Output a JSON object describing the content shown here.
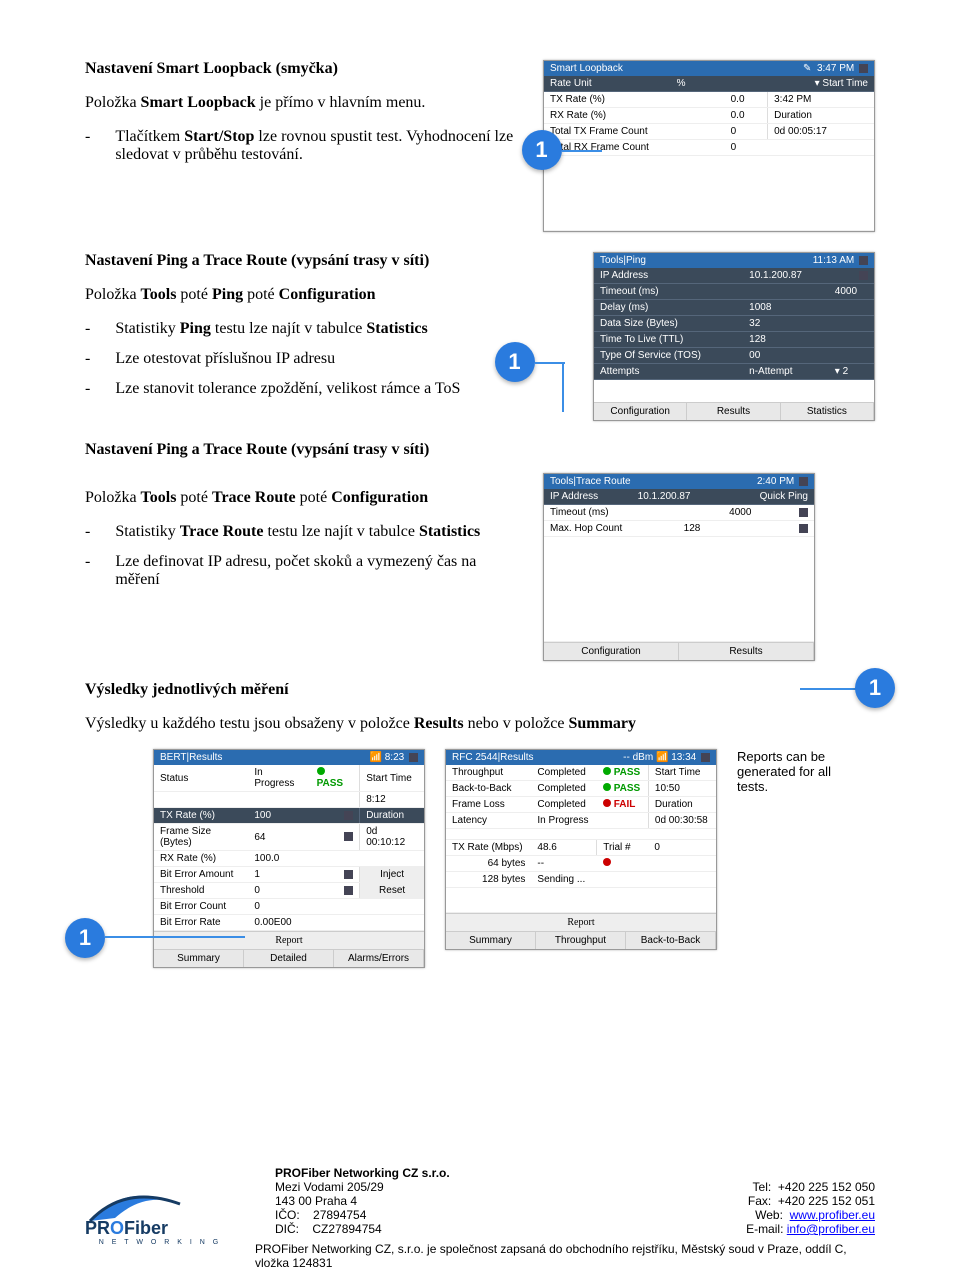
{
  "sec1": {
    "title": "Nastavení Smart Loopback (smyčka)",
    "intro": "Položka Smart Loopback je přímo v hlavním menu.",
    "b1": "Tlačítkem Start/Stop lze rovnou spustit test. Vyhodnocení lze sledovat v průběhu testování."
  },
  "sec2": {
    "title": "Nastavení Ping a Trace Route (vypsání trasy v síti)",
    "intro": "Položka Tools poté Ping poté Configuration",
    "b1": "Statistiky Ping testu lze najít v tabulce Statistics",
    "b2": "Lze otestovat příslušnou IP adresu",
    "b3": "Lze stanovit tolerance zpoždění, velikost rámce a ToS"
  },
  "sec3": {
    "title": "Nastavení Ping a Trace Route (vypsání trasy v síti)",
    "intro": "Položka Tools poté Trace Route poté Configuration",
    "b1": "Statistiky Trace Route testu lze najít v tabulce Statistics",
    "b2": "Lze definovat IP adresu, počet skoků a vymezený čas na měření"
  },
  "sec4": {
    "title": "Výsledky jednotlivých měření",
    "intro": "Výsledky u každého testu jsou obsaženy v položce Results nebo v položce Summary",
    "caption": "Reports can be generated for all tests."
  },
  "scr_loop": {
    "title": "Smart Loopback",
    "time": "3:47 PM",
    "rows": [
      [
        "Rate Unit",
        "%",
        "Start Time"
      ],
      [
        "TX Rate (%)",
        "0.0",
        "3:42 PM"
      ],
      [
        "RX Rate (%)",
        "0.0",
        "Duration"
      ],
      [
        "Total TX Frame Count",
        "0",
        "0d 00:05:17"
      ],
      [
        "Total RX Frame Count",
        "0",
        ""
      ]
    ]
  },
  "scr_ping": {
    "title": "Tools|Ping",
    "time": "11:13 AM",
    "rows": [
      [
        "IP Address",
        "10.1.200.87",
        ""
      ],
      [
        "Timeout (ms)",
        "",
        "4000"
      ],
      [
        "Delay (ms)",
        "1008",
        ""
      ],
      [
        "Data Size (Bytes)",
        "32",
        ""
      ],
      [
        "Time To Live (TTL)",
        "128",
        ""
      ],
      [
        "Type Of Service (TOS)",
        "00",
        ""
      ],
      [
        "Attempts",
        "n-Attempt",
        "2"
      ]
    ],
    "tabs": [
      "Configuration",
      "Results",
      "Statistics"
    ]
  },
  "scr_trace": {
    "title": "Tools|Trace Route",
    "time": "2:40 PM",
    "rows": [
      [
        "IP Address",
        "10.1.200.87",
        "Quick Ping"
      ],
      [
        "Timeout (ms)",
        "",
        "4000"
      ],
      [
        "Max. Hop Count",
        "128",
        ""
      ]
    ],
    "tabs": [
      "Configuration",
      "Results"
    ]
  },
  "scr_bert": {
    "title": "BERT|Results",
    "time": "8:23",
    "rows": [
      [
        "Status",
        "In Progress",
        "PASS",
        "Start Time"
      ],
      [
        "",
        "",
        "",
        "8:12"
      ],
      [
        "TX Rate (%)",
        "100",
        "",
        "Duration"
      ],
      [
        "Frame Size (Bytes)",
        "64",
        "",
        "0d 00:10:12"
      ],
      [
        "RX Rate (%)",
        "100.0",
        "",
        ""
      ],
      [
        "Bit Error Amount",
        "1",
        "",
        "Inject"
      ],
      [
        "Threshold",
        "0",
        "",
        "Reset"
      ],
      [
        "Bit Error Count",
        "0",
        "",
        ""
      ],
      [
        "Bit Error Rate",
        "0.00E00",
        "",
        ""
      ]
    ],
    "report": "Report",
    "tabs": [
      "Summary",
      "Detailed",
      "Alarms/Errors"
    ]
  },
  "scr_rfc": {
    "title": "RFC 2544|Results",
    "sig": "-- dBm",
    "time": "13:34",
    "rows": [
      [
        "Throughput",
        "Completed",
        "PASS",
        "Start Time"
      ],
      [
        "Back-to-Back",
        "Completed",
        "PASS",
        "10:50"
      ],
      [
        "Frame Loss",
        "Completed",
        "FAIL",
        "Duration"
      ],
      [
        "Latency",
        "In Progress",
        "",
        "0d 00:30:58"
      ],
      [
        "TX Rate (Mbps)",
        "48.6",
        "Trial #",
        "0"
      ],
      [
        "64 bytes",
        "--",
        "",
        ""
      ],
      [
        "128 bytes",
        "Sending ...",
        "",
        ""
      ]
    ],
    "report": "Report",
    "tabs": [
      "Summary",
      "Throughput",
      "Back-to-Back"
    ]
  },
  "footer": {
    "company": "PROFiber Networking CZ  s.r.o.",
    "addr1": "Mezi Vodami 205/29",
    "addr2": "143 00 Praha 4",
    "ico_l": "IČO:",
    "ico_v": "27894754",
    "dic_l": "DIČ:",
    "dic_v": "CZ27894754",
    "tel_l": "Tel:",
    "tel_v": "+420 225 152 050",
    "fax_l": "Fax:",
    "fax_v": "+420 225 152 051",
    "web_l": "Web:",
    "web_v": "www.profiber.eu",
    "mail_l": "E-mail:",
    "mail_v": "info@profiber.eu",
    "note": "PROFiber Networking CZ, s.r.o. je společnost zapsaná do obchodního rejstříku, Městský soud v Praze, oddíl C, vložka 124831"
  }
}
